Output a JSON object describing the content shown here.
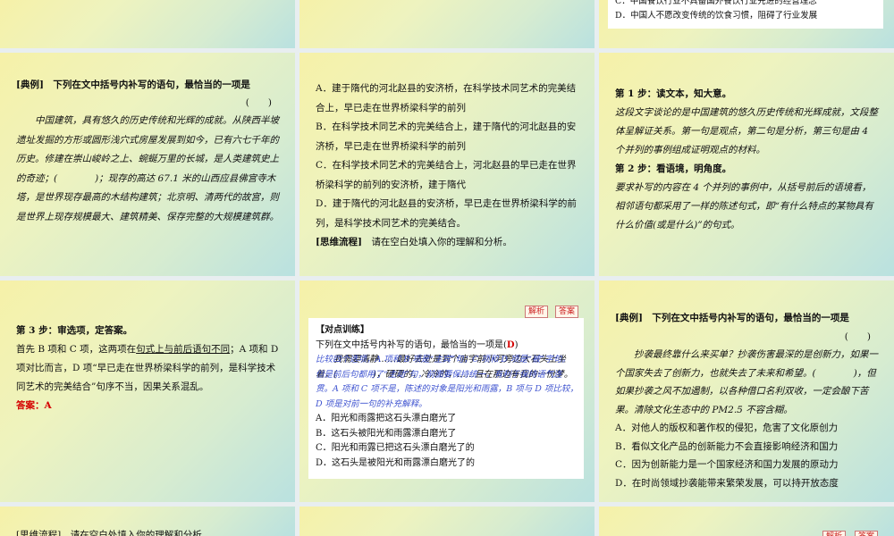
{
  "row0": {
    "right_options": [
      "C．中国餐饮行业不具备国外餐饮行业先进的经营理念",
      "D．中国人不愿改变传统的饮食习惯，阻碍了行业发展"
    ]
  },
  "slide_a": {
    "title": "[典例]　下列在文中括号内补写的语句，最恰当的一项是",
    "blank": "(　　)",
    "passage": "中国建筑，具有悠久的历史传统和光辉的成就。从陕西半坡遗址发掘的方形或圆形浅穴式房屋发展到如今，已有六七千年的历史。修建在崇山峻岭之上、蜿蜒万里的长城，是人类建筑史上的奇迹；(　　　　)；现存的高达 67.1 米的山西应县佛宫寺木塔，是世界现存最高的木结构建筑；北京明、清两代的故宫，则是世界上现存规模最大、建筑精美、保存完整的大规模建筑群。"
  },
  "slide_b": {
    "options": [
      "A．建于隋代的河北赵县的安济桥，在科学技术同艺术的完美结合上，早已走在世界桥梁科学的前列",
      "B．在科学技术同艺术的完美结合上，建于隋代的河北赵县的安济桥，早已走在世界桥梁科学的前列",
      "C．在科学技术同艺术的完美结合上，河北赵县的早已走在世界桥梁科学的前列的安济桥，建于隋代",
      "D．建于隋代的河北赵县的安济桥，早已走在世界桥梁科学的前列，是科学技术同艺术的完美结合。"
    ],
    "flow_label": "[思维流程]",
    "flow_text": "请在空白处填入你的理解和分析。"
  },
  "slide_c": {
    "step1_title": "第 1 步：读文本，知大意。",
    "step1_text": "这段文字谈论的是中国建筑的悠久历史传统和光辉成就，文段整体呈解证关系。第一句是观点，第二句是分析，第三句是由 4 个并列的事例组成证明观点的材料。",
    "step2_title": "第 2 步：看语境，明角度。",
    "step2_text": "要求补写的内容在 4 个并列的事例中，从括号前后的语境看，相邻语句都采用了一样的陈述句式，即“有什么特点的某物具有什么价值(或是什么)”的句式。"
  },
  "slide_d": {
    "step3_title": "第 3 步：审选项，定答案。",
    "step3_text_a": "首先 B 项和 C 项，这两项在",
    "step3_underlined": "句式上与前后语句不同",
    "step3_text_b": "；A 项和 D 项对比而言，D 项“早已走在世界桥梁科学的前列，是科学技术同艺术的完美结合”句序不当，因果关系混乱。",
    "answer": "答案：A"
  },
  "slide_e": {
    "btn_analysis": "解析",
    "btn_answer": "答案",
    "heading": "【对点训练】",
    "question": "下列在文中括号内补写的语句，最恰当的一项是(",
    "answer_letter": "D",
    "question_end": ")",
    "passage": "我需要清静……最好去处是到个庙宇前小河旁边大石头上坐着，(　　　　)，硬硬的，冷冷的，……且在那边有我的一份梦。",
    "analysis": "比较四个选项，A 项和 B 项是“主宾”句；C 项和 D 项是“被”字句。但是前后句都用了“主动”句，前面要保持统一，有利于保持语气连贯。A 项和 C 项不是，陈述的对象是阳光和雨露，B 项与 D 项比较，D 项是对前一句的补充解释。",
    "options": [
      "A．阳光和雨露把这石头漂白磨光了",
      "B．这石头被阳光和雨露漂白磨光了",
      "C．阳光和雨露已把这石头漂白磨光了的",
      "D．这石头是被阳光和雨露漂白磨光了的"
    ]
  },
  "slide_f": {
    "title": "[典例]　下列在文中括号内补写的语句，最恰当的一项是",
    "blank": "(　　)",
    "passage": "抄袭最终靠什么来买单？抄袭伤害最深的是创新力，如果一个国家失去了创新力，也就失去了未来和希望。(　　　　)，但如果抄袭之风不加遏制，以各种借口名利双收，一定会酿下苦果。清除文化生态中的 PM2.5 不容含糊。",
    "options": [
      "A．对他人的版权和著作权的侵犯，危害了文化原创力",
      "B．看似文化产品的创新能力不会直接影响经济和国力",
      "C．因为创新能力是一个国家经济和国力发展的原动力",
      "D．在时尚领域抄袭能带来繁荣发展，可以持开放态度"
    ]
  },
  "row3": {
    "left_text": "[思维流程]　请在空白处填入你的理解和分析。",
    "right_btn_analysis": "解析",
    "right_btn_answer": "答案"
  }
}
